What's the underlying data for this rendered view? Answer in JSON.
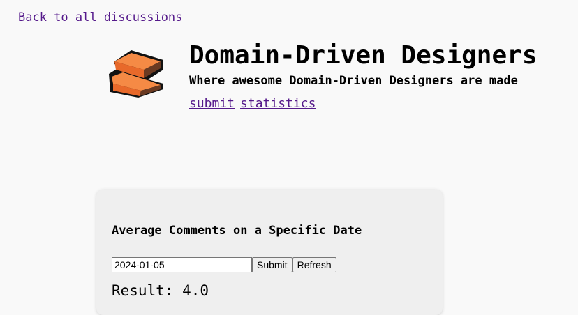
{
  "nav": {
    "back_label": "Back to all discussions"
  },
  "header": {
    "logo_icon": "bricks-logo-icon",
    "title": "Domain-Driven Designers",
    "tagline": "Where awesome Domain-Driven Designers are made",
    "links": [
      "submit",
      "statistics"
    ]
  },
  "stats_card": {
    "title": "Average Comments on a Specific Date",
    "date_value": "2024-01-05",
    "submit_label": "Submit",
    "refresh_label": "Refresh",
    "result_text": "Result: 4.0"
  },
  "colors": {
    "background": "#f9f9f9",
    "card_background": "#efefef",
    "link": "#551a8b",
    "logo_orange": "#f07f3c",
    "logo_dark": "#6a3a22"
  }
}
